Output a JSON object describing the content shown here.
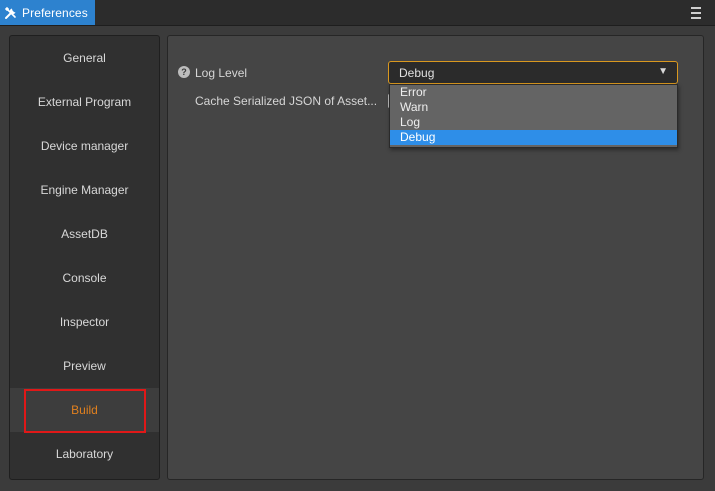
{
  "window": {
    "tab_title": "Preferences",
    "tab_icon": "tools-icon",
    "menu_icon": "hamburger-menu-icon",
    "accent_color": "#2d82cf"
  },
  "sidebar": {
    "items": [
      {
        "label": "General"
      },
      {
        "label": "External Program"
      },
      {
        "label": "Device manager"
      },
      {
        "label": "Engine Manager"
      },
      {
        "label": "AssetDB"
      },
      {
        "label": "Console"
      },
      {
        "label": "Inspector"
      },
      {
        "label": "Preview"
      },
      {
        "label": "Build",
        "active": true
      },
      {
        "label": "Laboratory"
      }
    ],
    "active_color": "#e0801f"
  },
  "panel": {
    "log_level": {
      "label": "Log Level",
      "help_icon": "question-circle-icon",
      "value": "Debug",
      "options": [
        "Error",
        "Warn",
        "Log",
        "Debug"
      ],
      "selected": "Debug"
    },
    "cache_json": {
      "label": "Cache Serialized JSON of Asset..."
    }
  }
}
